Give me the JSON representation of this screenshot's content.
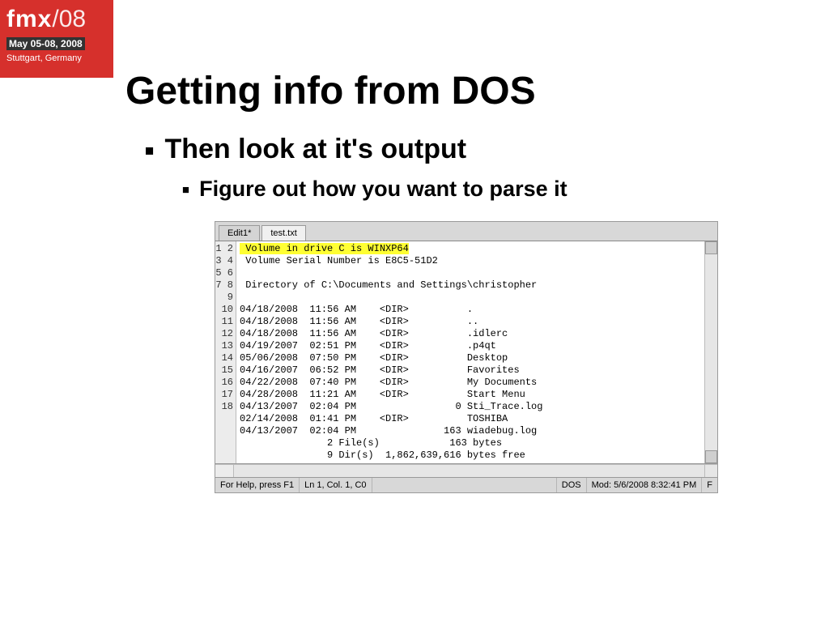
{
  "brand": {
    "name": "fmx",
    "slashnum": "/08",
    "dates": "May 05-08, 2008",
    "location": "Stuttgart, Germany"
  },
  "slide": {
    "title": "Getting info from DOS",
    "bullet1": "Then look at it's output",
    "bullet2": "Figure out how you want to parse it"
  },
  "editor": {
    "tabs": {
      "tab1": "Edit1*",
      "tab2": "test.txt"
    },
    "gutter_lines": "1\n2\n3\n4\n5\n6\n7\n8\n9\n10\n11\n12\n13\n14\n15\n16\n17\n18",
    "line1": " Volume in drive C is WINXP64",
    "rest": " Volume Serial Number is E8C5-51D2\n\n Directory of C:\\Documents and Settings\\christopher\n\n04/18/2008  11:56 AM    <DIR>          .\n04/18/2008  11:56 AM    <DIR>          ..\n04/18/2008  11:56 AM    <DIR>          .idlerc\n04/19/2007  02:51 PM    <DIR>          .p4qt\n05/06/2008  07:50 PM    <DIR>          Desktop\n04/16/2007  06:52 PM    <DIR>          Favorites\n04/22/2008  07:40 PM    <DIR>          My Documents\n04/28/2008  11:21 AM    <DIR>          Start Menu\n04/13/2007  02:04 PM                 0 Sti_Trace.log\n02/14/2008  01:41 PM    <DIR>          TOSHIBA\n04/13/2007  02:04 PM               163 wiadebug.log\n               2 File(s)            163 bytes\n               9 Dir(s)  1,862,639,616 bytes free",
    "status": {
      "help": "For Help, press F1",
      "pos": "Ln 1, Col. 1, C0",
      "enc": "DOS",
      "mod": "Mod: 5/6/2008 8:32:41 PM",
      "flag": "F"
    }
  }
}
